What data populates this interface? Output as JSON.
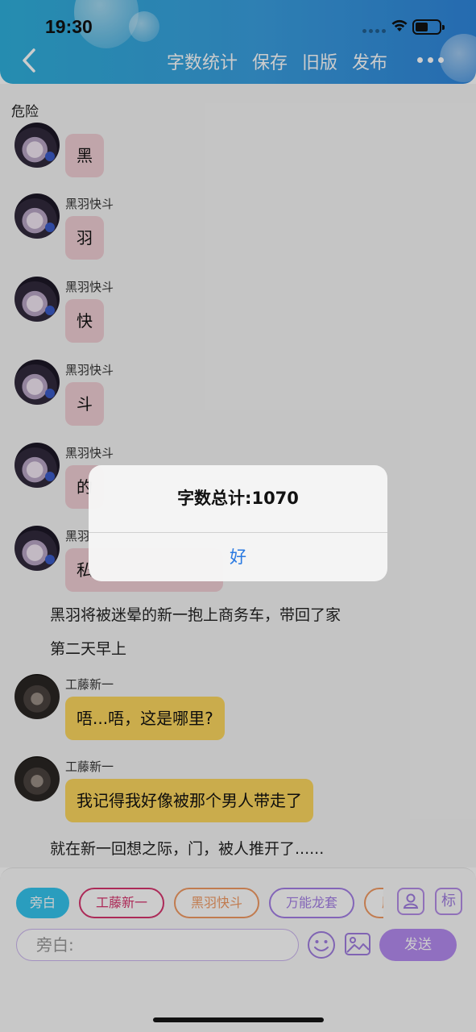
{
  "status_bar": {
    "time": "19:30"
  },
  "header": {
    "back_icon": "chevron-left-icon",
    "actions": [
      "字数统计",
      "保存",
      "旧版",
      "发布"
    ],
    "more_icon": "more-dots-icon",
    "colors": {
      "start": "#2fb0dc",
      "end": "#2f86dc"
    }
  },
  "chat": {
    "chapter_title": "危险",
    "messages": [
      {
        "sender": "",
        "text": "黑"
      },
      {
        "sender": "黑羽快斗",
        "text": "羽"
      },
      {
        "sender": "黑羽快斗",
        "text": "快"
      },
      {
        "sender": "黑羽快斗",
        "text": "斗"
      },
      {
        "sender": "黑羽快斗",
        "text": "的"
      },
      {
        "sender": "黑羽",
        "text": "私"
      }
    ],
    "narration_1": "黑羽将被迷晕的新一抱上商务车，带回了家",
    "narration_2": "第二天早上",
    "shinichi_messages": [
      {
        "sender": "工藤新一",
        "text": "唔...唔，这是哪里?"
      },
      {
        "sender": "工藤新一",
        "text": "我记得我好像被那个男人带走了"
      }
    ],
    "narration_3": "就在新一回想之际，门，被人推开了......",
    "bubble_colors": {
      "kaito": "#f1cfd5",
      "shinichi": "#fdd75f"
    }
  },
  "composer": {
    "roles": [
      {
        "label": "旁白",
        "color": "#35c5ee"
      },
      {
        "label": "工藤新一",
        "color": "#d8356e"
      },
      {
        "label": "黑羽快斗",
        "color": "#f29a63"
      },
      {
        "label": "万能龙套",
        "color": "#a47fe6"
      },
      {
        "label": "肋",
        "color": "#f29a63"
      }
    ],
    "role_manager_icon": "person-card-icon",
    "tag_button": "标",
    "input_placeholder": "旁白:",
    "emoji_icon": "smiley-icon",
    "image_icon": "image-icon",
    "send_label": "发送",
    "send_color": "#b58bf0"
  },
  "alert": {
    "title": "字数总计:1070",
    "ok_label": "好",
    "ok_color": "#2a7ae2"
  }
}
